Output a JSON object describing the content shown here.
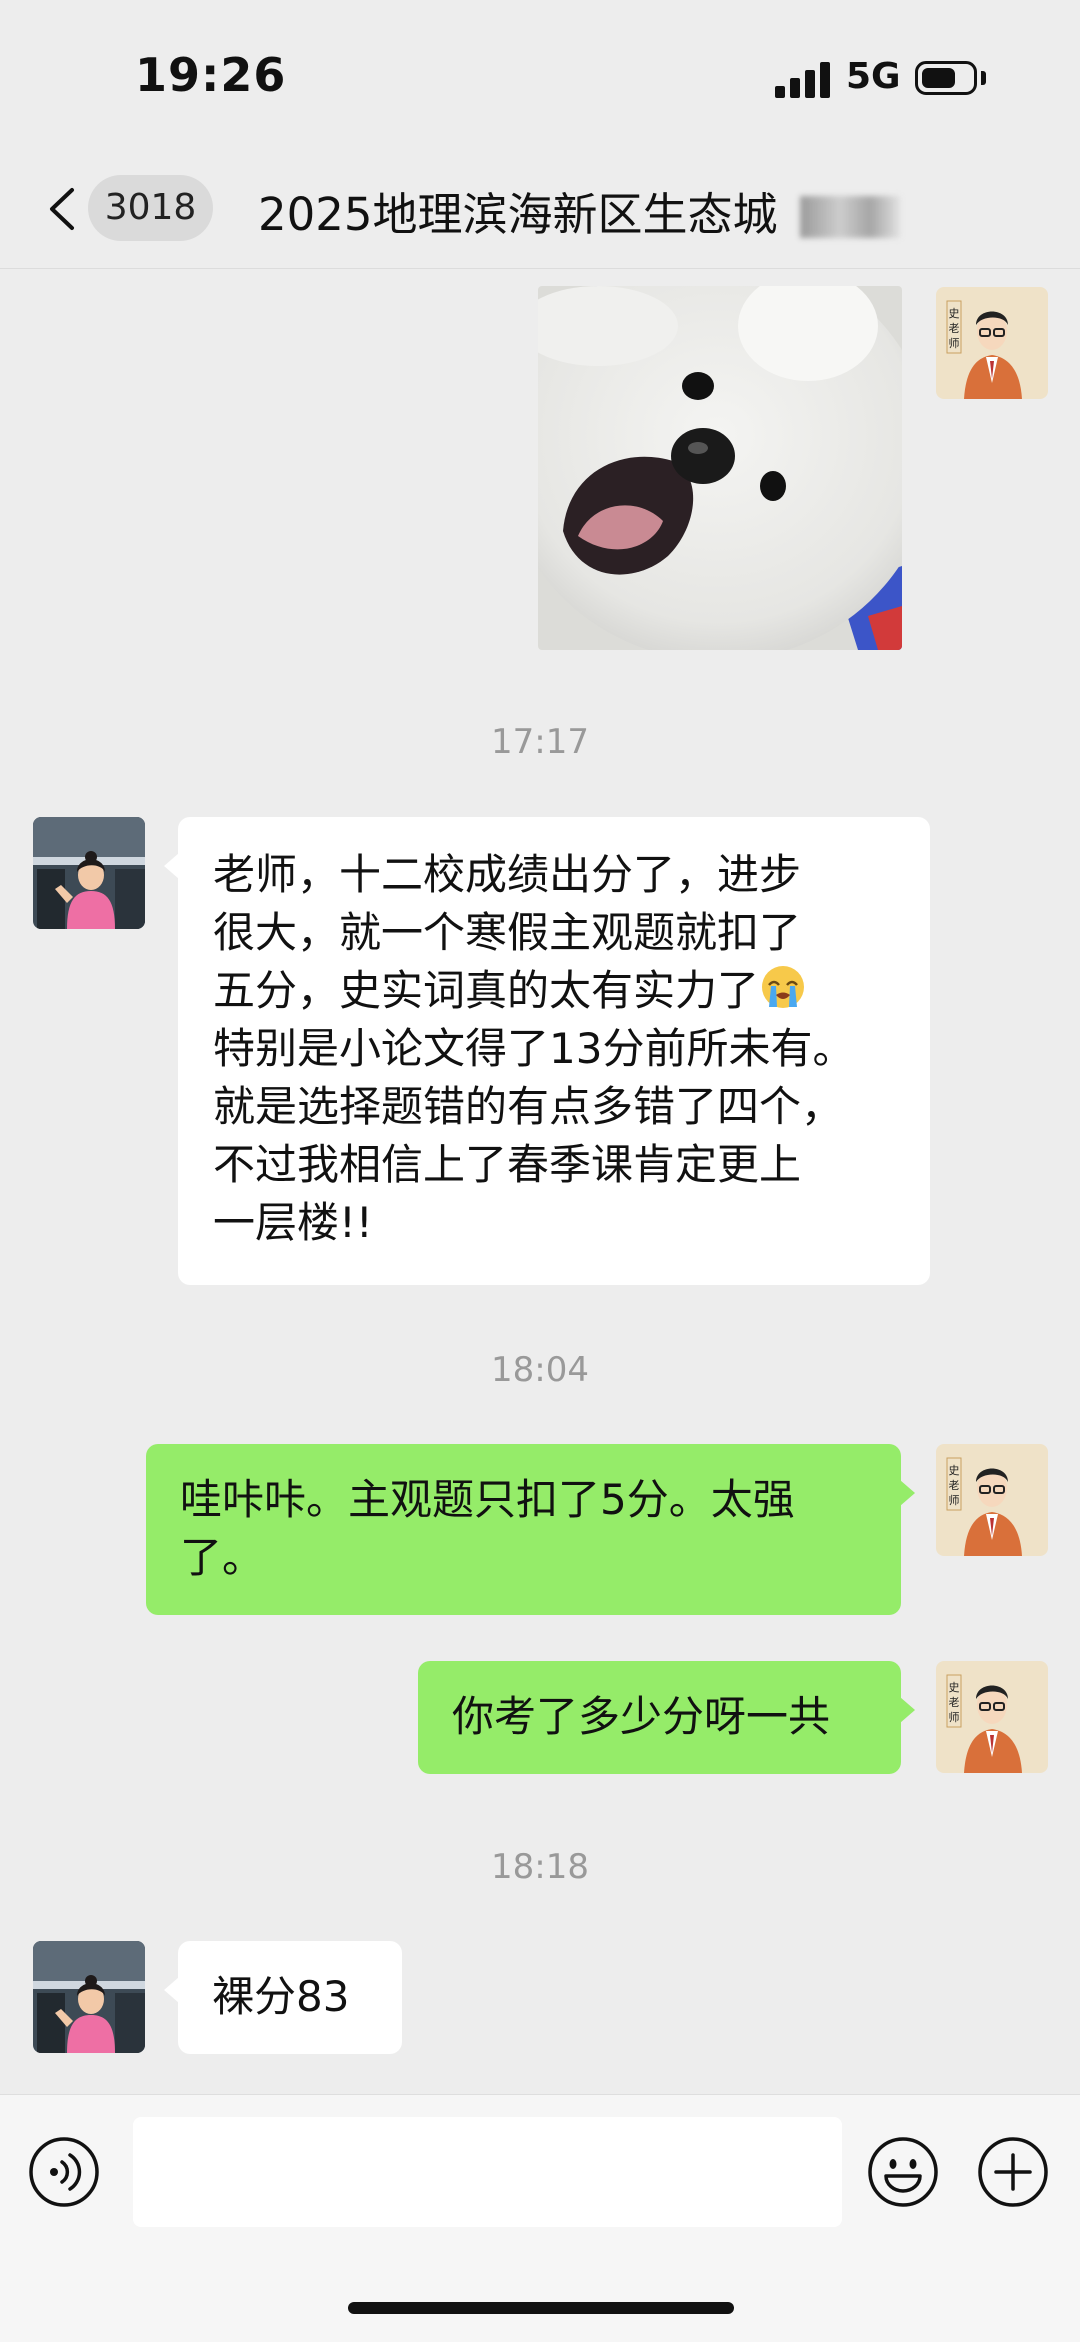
{
  "status_bar": {
    "time": "19:26",
    "network": "5G",
    "battery_level": 0.65
  },
  "header": {
    "unread_count": "3018",
    "title": "2025地理滨海新区生态城"
  },
  "messages": [
    {
      "type": "image",
      "side": "right",
      "sender": "teacher"
    },
    {
      "type": "timestamp",
      "text": "17:17"
    },
    {
      "type": "text",
      "side": "left",
      "sender": "student",
      "lines": [
        "老师，十二校成绩出分了，进步",
        "很大，就一个寒假主观题就扣了",
        "五分，史实词真的太有实力了",
        "特别是小论文得了13分前所未有。",
        "就是选择题错的有点多错了四个，",
        "不过我相信上了春季课肯定更上",
        "一层楼!!"
      ],
      "emoji": "crying-face"
    },
    {
      "type": "timestamp",
      "text": "18:04"
    },
    {
      "type": "text",
      "side": "right",
      "sender": "teacher",
      "lines": [
        "哇咔咔。主观题只扣了5分。太强",
        "了。"
      ]
    },
    {
      "type": "text",
      "side": "right",
      "sender": "teacher",
      "lines": [
        "你考了多少分呀一共"
      ]
    },
    {
      "type": "timestamp",
      "text": "18:18"
    },
    {
      "type": "text",
      "side": "left",
      "sender": "student",
      "lines": [
        "裸分83"
      ]
    }
  ],
  "avatars": {
    "teacher_caption": "史老师"
  },
  "colors": {
    "background": "#ededed",
    "outgoing_bubble": "#95ec69",
    "incoming_bubble": "#ffffff",
    "timestamp": "#999999"
  },
  "icons": {
    "back": "chevron-left-icon",
    "voice": "voice-icon",
    "emoji": "smiley-icon",
    "more": "plus-icon"
  }
}
